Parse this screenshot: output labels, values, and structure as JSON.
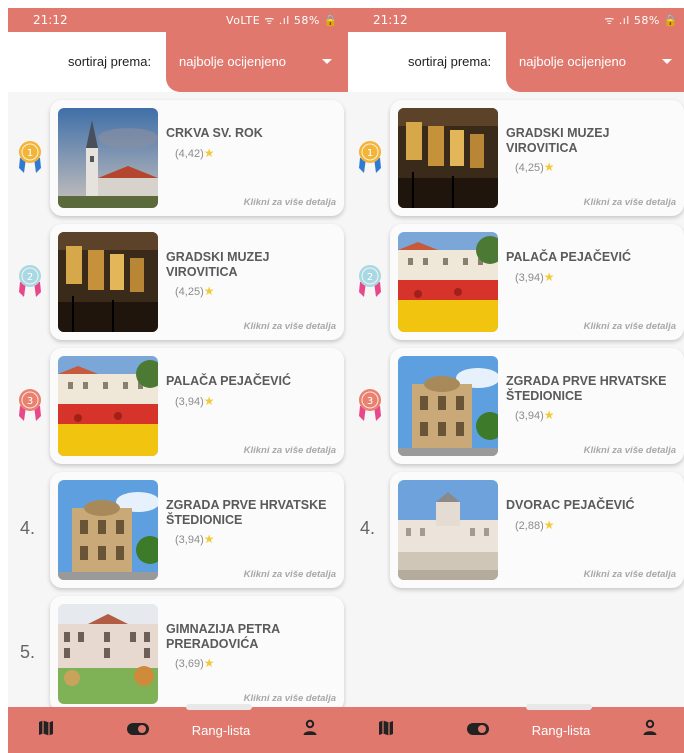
{
  "colors": {
    "accent": "#e0786d",
    "card": "#fbfbfb",
    "title": "#5a5a5a",
    "star": "#f3c93a"
  },
  "screens": [
    {
      "statusbar": {
        "time": "21:12",
        "icons": "VoLTE ᯤ .ıl 58% 🔒",
        "battery": "58%"
      },
      "sort": {
        "label": "sortiraj prema:",
        "value": "najbolje ocijenjeno"
      },
      "items": [
        {
          "rank": "1",
          "medal": "gold",
          "title": "CRKVA SV. ROK",
          "rating": "(4,42)",
          "detail": "Klikni za više detalja",
          "image": "church"
        },
        {
          "rank": "2",
          "medal": "silver",
          "title": "GRADSKI MUZEJ VIROVITICA",
          "rating": "(4,25)",
          "detail": "Klikni za više detalja",
          "image": "museum"
        },
        {
          "rank": "3",
          "medal": "bronze",
          "title": "PALAČA PEJAČEVIĆ",
          "rating": "(3,94)",
          "detail": "Klikni za više detalja",
          "image": "palace"
        },
        {
          "rank": "4.",
          "medal": "",
          "title": "ZGRADA PRVE HRVATSKE ŠTEDIONICE",
          "rating": "(3,94)",
          "detail": "Klikni za više detalja",
          "image": "savings"
        },
        {
          "rank": "5.",
          "medal": "",
          "title": "GIMNAZIJA PETRA PRERADOVIĆA",
          "rating": "(3,69)",
          "detail": "Klikni za više detalja",
          "image": "school"
        }
      ],
      "nav": {
        "map": "map-icon",
        "toggle": "toggle-icon",
        "active_label": "Rang-lista",
        "profile": "profile-icon"
      }
    },
    {
      "statusbar": {
        "time": "21:12",
        "icons": "ᯤ .ıl 58% 🔒",
        "battery": "58%"
      },
      "sort": {
        "label": "sortiraj prema:",
        "value": "najbolje ocijenjeno"
      },
      "items": [
        {
          "rank": "1",
          "medal": "gold",
          "title": "GRADSKI MUZEJ VIROVITICA",
          "rating": "(4,25)",
          "detail": "Klikni za više detalja",
          "image": "museum"
        },
        {
          "rank": "2",
          "medal": "silver",
          "title": "PALAČA PEJAČEVIĆ",
          "rating": "(3,94)",
          "detail": "Klikni za više detalja",
          "image": "palace"
        },
        {
          "rank": "3",
          "medal": "bronze",
          "title": "ZGRADA PRVE HRVATSKE ŠTEDIONICE",
          "rating": "(3,94)",
          "detail": "Klikni za više detalja",
          "image": "savings"
        },
        {
          "rank": "4.",
          "medal": "",
          "title": "DVORAC PEJAČEVIĆ",
          "rating": "(2,88)",
          "detail": "Klikni za više detalja",
          "image": "castle"
        }
      ],
      "nav": {
        "map": "map-icon",
        "toggle": "toggle-icon",
        "active_label": "Rang-lista",
        "profile": "profile-icon"
      }
    }
  ]
}
